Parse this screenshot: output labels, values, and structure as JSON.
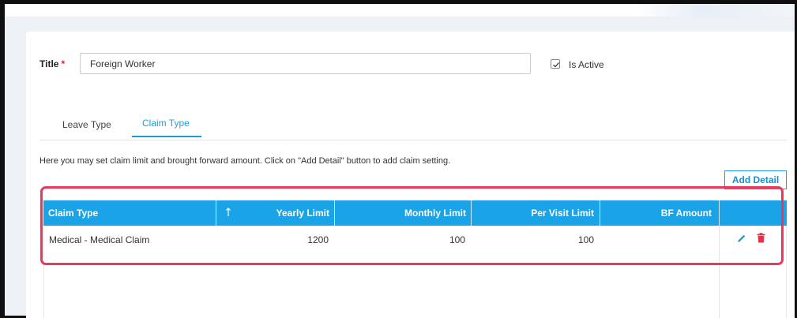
{
  "form": {
    "title_label": "Title",
    "required_marker": "*",
    "title_value": "Foreign Worker",
    "is_active_label": "Is Active",
    "is_active_checked": true
  },
  "tabs": [
    {
      "label": "Leave Type",
      "active": false
    },
    {
      "label": "Claim Type",
      "active": true
    }
  ],
  "info_text": "Here you may set claim limit and brought forward amount. Click on \"Add Detail\" button to add claim setting.",
  "add_detail_label": "Add Detail",
  "table": {
    "columns": [
      "Claim Type",
      "Yearly Limit",
      "Monthly Limit",
      "Per Visit Limit",
      "BF Amount"
    ],
    "sort_icon": "arrow-up-icon",
    "rows": [
      {
        "claim_type": "Medical - Medical Claim",
        "yearly_limit": "1200",
        "monthly_limit": "100",
        "per_visit_limit": "100",
        "bf_amount": ""
      }
    ]
  },
  "colors": {
    "accent": "#1aa3e6",
    "required": "#e0202d",
    "highlight": "#e8385e",
    "delete": "#e8304a"
  }
}
